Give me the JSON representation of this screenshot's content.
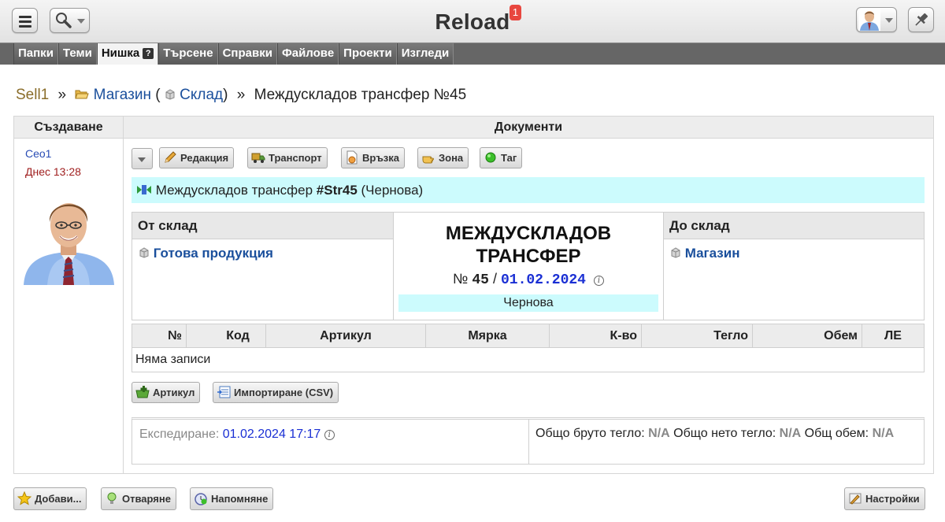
{
  "app": {
    "title": "Reload",
    "notification_count": "1"
  },
  "tabs": [
    {
      "label": "Папки"
    },
    {
      "label": "Теми"
    },
    {
      "label": "Нишка",
      "help": "?"
    },
    {
      "label": "Търсене"
    },
    {
      "label": "Справки"
    },
    {
      "label": "Файлове"
    },
    {
      "label": "Проекти"
    },
    {
      "label": "Изгледи"
    }
  ],
  "breadcrumb": {
    "root": "Sell1",
    "sep": "»",
    "store": "Магазин",
    "warehouse": "Склад",
    "current": "Междускладов трансфер №45"
  },
  "left_column": {
    "header": "Създаване",
    "author": "Ceo1",
    "created": "Днес 13:28"
  },
  "documents": {
    "header": "Документи",
    "toolbar": [
      "Редакция",
      "Транспорт",
      "Връзка",
      "Зона",
      "Таг"
    ],
    "banner": {
      "title": "Междускладов трансфер",
      "code": "#Str45",
      "status": "(Чернова)"
    },
    "from": {
      "label": "От склад",
      "value": "Готова продукция"
    },
    "to": {
      "label": "До склад",
      "value": "Магазин"
    },
    "doc_title_line1": "МЕЖДУСКЛАДОВ",
    "doc_title_line2": "ТРАНСФЕР",
    "number_prefix": "№",
    "number": "45",
    "slash": "/",
    "date": "01.02.2024",
    "status": "Чернова",
    "columns": [
      "№",
      "Код",
      "Артикул",
      "Мярка",
      "К-во",
      "Тегло",
      "Обем",
      "ЛЕ"
    ],
    "empty_text": "Няма записи",
    "item_buttons": [
      "Артикул",
      "Импортиране (CSV)"
    ],
    "shipping": {
      "label": "Експедиране:",
      "value": "01.02.2024 17:17"
    },
    "weights": {
      "gross_label": "Общо бруто тегло:",
      "gross": "N/A",
      "net_label": "Общо нето тегло:",
      "net": "N/A",
      "volume_label": "Общ обем:",
      "volume": "N/A"
    }
  },
  "bottom": {
    "add": "Добави...",
    "reply": "Отваряне",
    "reminder": "Напомняне",
    "settings": "Настройки"
  },
  "colors": {
    "link": "#1a4f9c",
    "cyan_bg": "#ccfbfd",
    "date": "#1a2fd4",
    "badge": "#e8473f"
  }
}
